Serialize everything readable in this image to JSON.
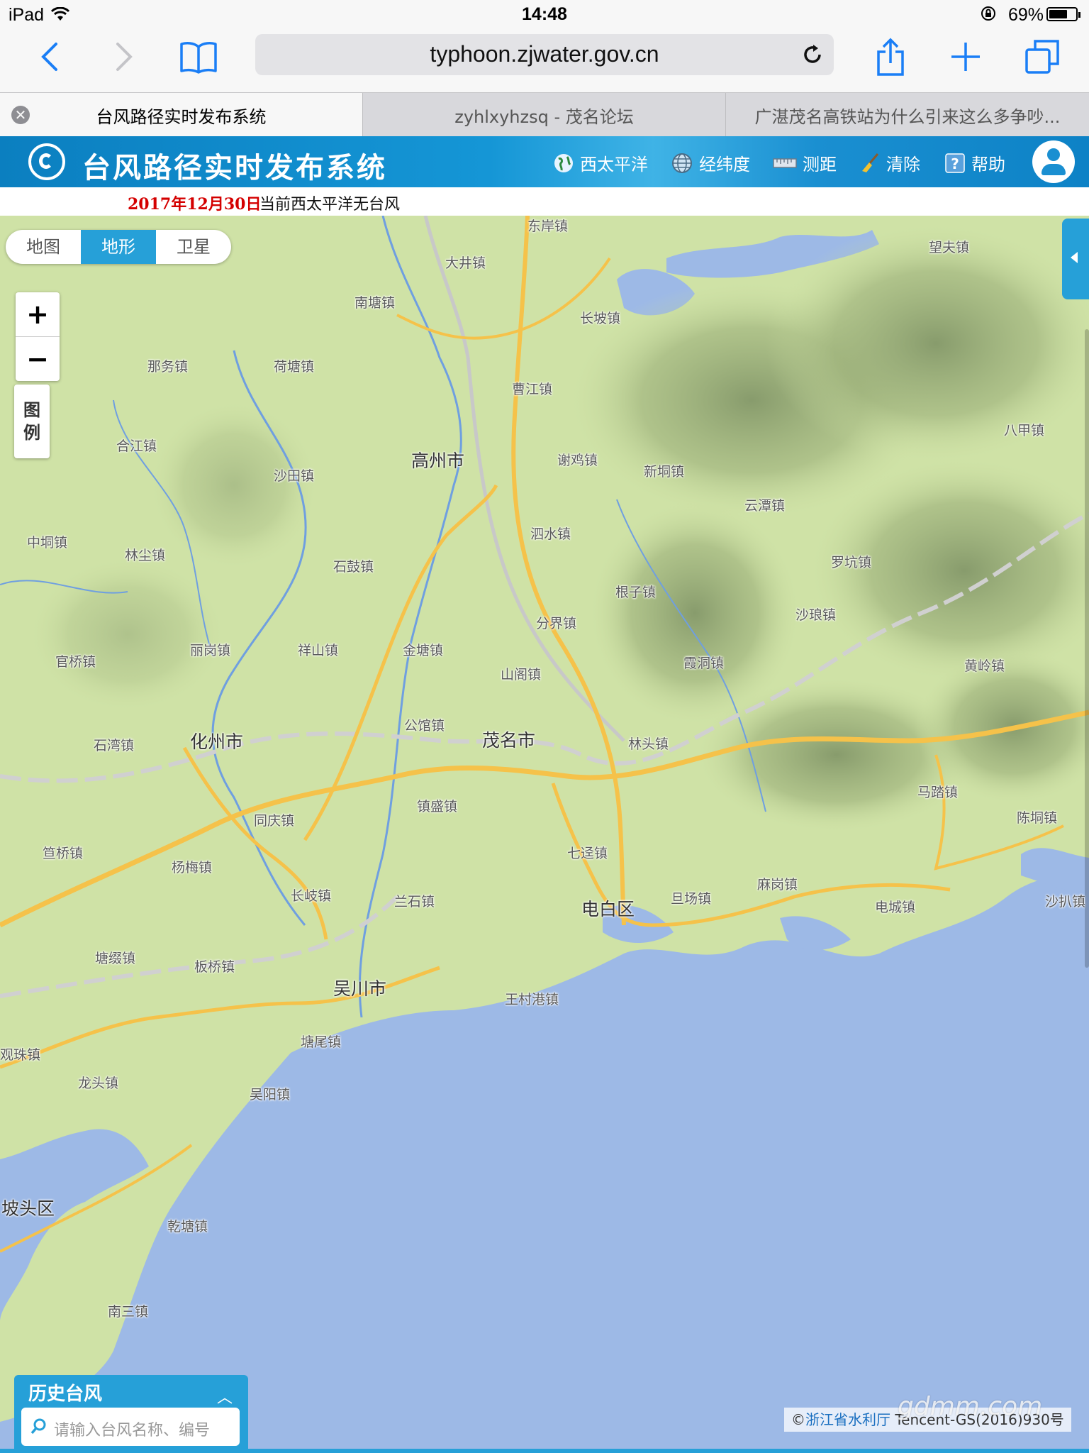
{
  "status_bar": {
    "device": "iPad",
    "time": "14:48",
    "battery": "69%",
    "battery_level": 0.69
  },
  "browser": {
    "url": "typhoon.zjwater.gov.cn",
    "tabs": [
      {
        "title": "台风路径实时发布系统",
        "active": true
      },
      {
        "title": "zyhlxyhzsq - 茂名论坛",
        "active": false
      },
      {
        "title": "广湛茂名高铁站为什么引来这么多争吵...",
        "active": false
      }
    ]
  },
  "header": {
    "title": "台风路径实时发布系统",
    "nav": [
      {
        "label": "西太平洋",
        "icon": "globe-icon"
      },
      {
        "label": "经纬度",
        "icon": "grid-globe-icon"
      },
      {
        "label": "测距",
        "icon": "ruler-icon"
      },
      {
        "label": "清除",
        "icon": "broom-icon"
      },
      {
        "label": "帮助",
        "icon": "help-icon"
      }
    ]
  },
  "notice": {
    "date": "2017年12月30日",
    "message": "当前西太平洋无台风"
  },
  "map": {
    "map_types": [
      "地图",
      "地形",
      "卫星"
    ],
    "selected_type": "地形",
    "zoom_in": "+",
    "zoom_out": "−",
    "legend": [
      "图",
      "例"
    ],
    "cities": [
      "高州市",
      "化州市",
      "茂名市",
      "电白区",
      "吴川市",
      "坡头区"
    ],
    "towns": [
      "东岸镇",
      "大井镇",
      "南塘镇",
      "长坡镇",
      "曹江镇",
      "那务镇",
      "荷塘镇",
      "合江镇",
      "沙田镇",
      "谢鸡镇",
      "新垌镇",
      "云潭镇",
      "中垌镇",
      "林尘镇",
      "石鼓镇",
      "泗水镇",
      "根子镇",
      "罗坑镇",
      "沙琅镇",
      "官桥镇",
      "丽岗镇",
      "祥山镇",
      "金塘镇",
      "分界镇",
      "山阁镇",
      "霞洞镇",
      "黄岭镇",
      "石湾镇",
      "公馆镇",
      "林头镇",
      "同庆镇",
      "镇盛镇",
      "马踏镇",
      "陈垌镇",
      "笪桥镇",
      "杨梅镇",
      "七迳镇",
      "长岐镇",
      "兰石镇",
      "旦场镇",
      "麻岗镇",
      "电城镇",
      "沙扒镇",
      "塘缀镇",
      "板桥镇",
      "王村港镇",
      "塘尾镇",
      "吴阳镇",
      "龙头镇",
      "乾塘镇",
      "南三镇",
      "观珠镇",
      "望夫镇",
      "八甲镇"
    ],
    "copyright_prefix": "©",
    "copyright_link": "浙江省水利厅",
    "copyright_suffix": "Tencent-GS(2016)930号",
    "watermark": "gdmm.com"
  },
  "history": {
    "title": "历史台风",
    "placeholder": "请输入台风名称、编号"
  },
  "colors": {
    "brand": "#1a8fd1",
    "accent": "#26a0d8",
    "land": "#cfe2a6",
    "sea": "#9db9e6",
    "road": "#f5c24a",
    "date": "#d40000"
  }
}
